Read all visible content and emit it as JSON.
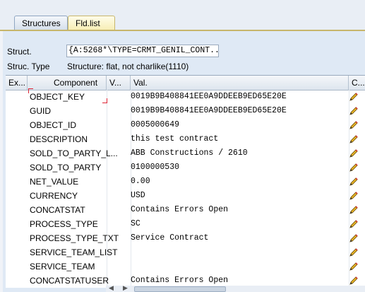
{
  "tabs": [
    {
      "label": "Structures"
    },
    {
      "label": "Fld.list"
    }
  ],
  "form": {
    "struct_label": "Struct.",
    "struct_value": "{A:5268*\\TYPE=CRMT_GENIL_CONT...",
    "struc_type_label": "Struc. Type",
    "struc_type_value": "Structure: flat, not charlike(1110)"
  },
  "grid": {
    "headers": {
      "ex": "Ex...",
      "component": "Component",
      "v": "V...",
      "val": "Val.",
      "c": "C..."
    },
    "rows": [
      {
        "component": "OBJECT_KEY",
        "value": "0019B9B408841EE0A9DDEEB9ED65E20E"
      },
      {
        "component": "GUID",
        "value": "0019B9B408841EE0A9DDEEB9ED65E20E"
      },
      {
        "component": "OBJECT_ID",
        "value": "0005000649"
      },
      {
        "component": "DESCRIPTION",
        "value": "this test contract"
      },
      {
        "component": "SOLD_TO_PARTY_L...",
        "value": "ABB Constructions / 2610"
      },
      {
        "component": "SOLD_TO_PARTY",
        "value": "0100000530"
      },
      {
        "component": "NET_VALUE",
        "value": "0.00"
      },
      {
        "component": "CURRENCY",
        "value": "USD"
      },
      {
        "component": "CONCATSTAT",
        "value": "Contains Errors Open"
      },
      {
        "component": "PROCESS_TYPE",
        "value": "SC"
      },
      {
        "component": "PROCESS_TYPE_TXT",
        "value": "Service Contract"
      },
      {
        "component": "SERVICE_TEAM_LIST",
        "value": ""
      },
      {
        "component": "SERVICE_TEAM",
        "value": ""
      },
      {
        "component": "CONCATSTATUSER",
        "value": "Contains Errors Open"
      }
    ]
  },
  "icons": {
    "edit": "pencil-icon",
    "scroll_left": "arrow-left-icon",
    "scroll_right": "arrow-right-icon"
  }
}
